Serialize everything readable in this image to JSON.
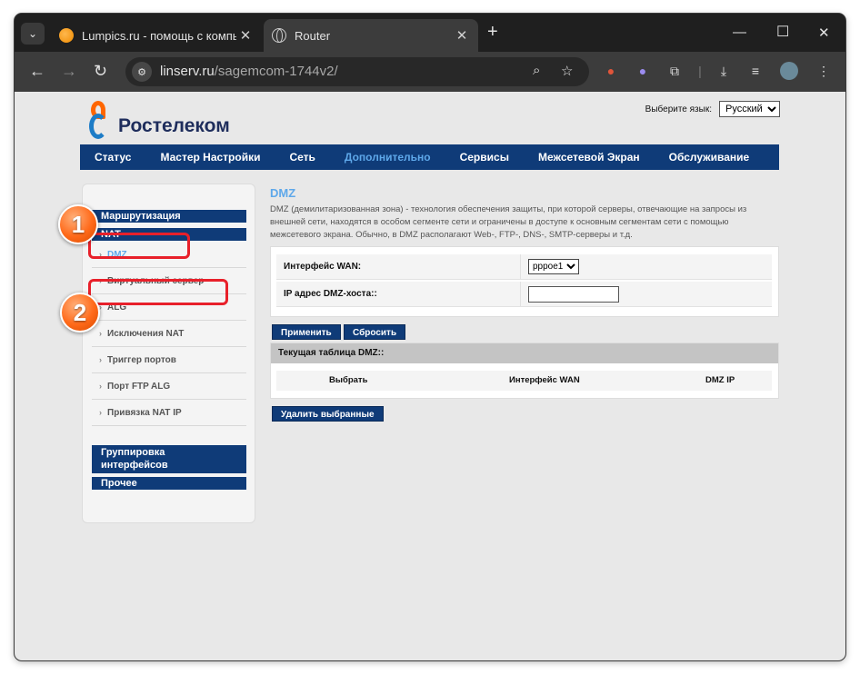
{
  "browser": {
    "tabs": [
      {
        "title": "Lumpics.ru - помощь с компьютером",
        "icon": "orange-favicon-icon",
        "active": false
      },
      {
        "title": "Router",
        "icon": "globe-icon",
        "active": true
      }
    ],
    "url_host": "linserv.ru",
    "url_path": "/sagemcom-1744v2/"
  },
  "router": {
    "brand": "Ростелеком",
    "language_label": "Выберите язык:",
    "language_value": "Русский",
    "nav": [
      {
        "label": "Статус",
        "active": false
      },
      {
        "label": "Мастер Настройки",
        "active": false
      },
      {
        "label": "Сеть",
        "active": false
      },
      {
        "label": "Дополнительно",
        "active": true
      },
      {
        "label": "Сервисы",
        "active": false
      },
      {
        "label": "Межсетевой Экран",
        "active": false
      },
      {
        "label": "Обслуживание",
        "active": false
      }
    ],
    "sidebar": {
      "routing": "Маршрутизация",
      "nat": "NAT",
      "items": [
        {
          "label": "DMZ",
          "active": true
        },
        {
          "label": "Виртуальный сервер",
          "active": false
        },
        {
          "label": "ALG",
          "active": false
        },
        {
          "label": "Исключения NAT",
          "active": false
        },
        {
          "label": "Триггер портов",
          "active": false
        },
        {
          "label": "Порт FTP ALG",
          "active": false
        },
        {
          "label": "Привязка NAT IP",
          "active": false
        }
      ],
      "group_line1": "Группировка",
      "group_line2": "интерфейсов",
      "other": "Прочее"
    },
    "content": {
      "title": "DMZ",
      "description": "DMZ (демилитаризованная зона) - технология обеспечения защиты, при которой серверы, отвечающие на запросы из внешней сети, находятся в особом сегменте сети и ограничены в доступе к основным сегментам сети с помощью межсетевого экрана. Обычно, в DMZ располагают Web-, FTP-, DNS-, SMTP-серверы и т.д.",
      "wan_label": "Интерфейс WAN:",
      "wan_value": "pppoe1",
      "host_label": "IP адрес DMZ-хоста::",
      "host_value": "",
      "apply_button": "Применить",
      "reset_button": "Сбросить",
      "table_title": "Текущая таблица DMZ::",
      "columns": [
        "Выбрать",
        "Интерфейс WAN",
        "DMZ IP"
      ],
      "delete_button": "Удалить выбранные"
    }
  },
  "callouts": [
    {
      "number": "1"
    },
    {
      "number": "2"
    }
  ]
}
